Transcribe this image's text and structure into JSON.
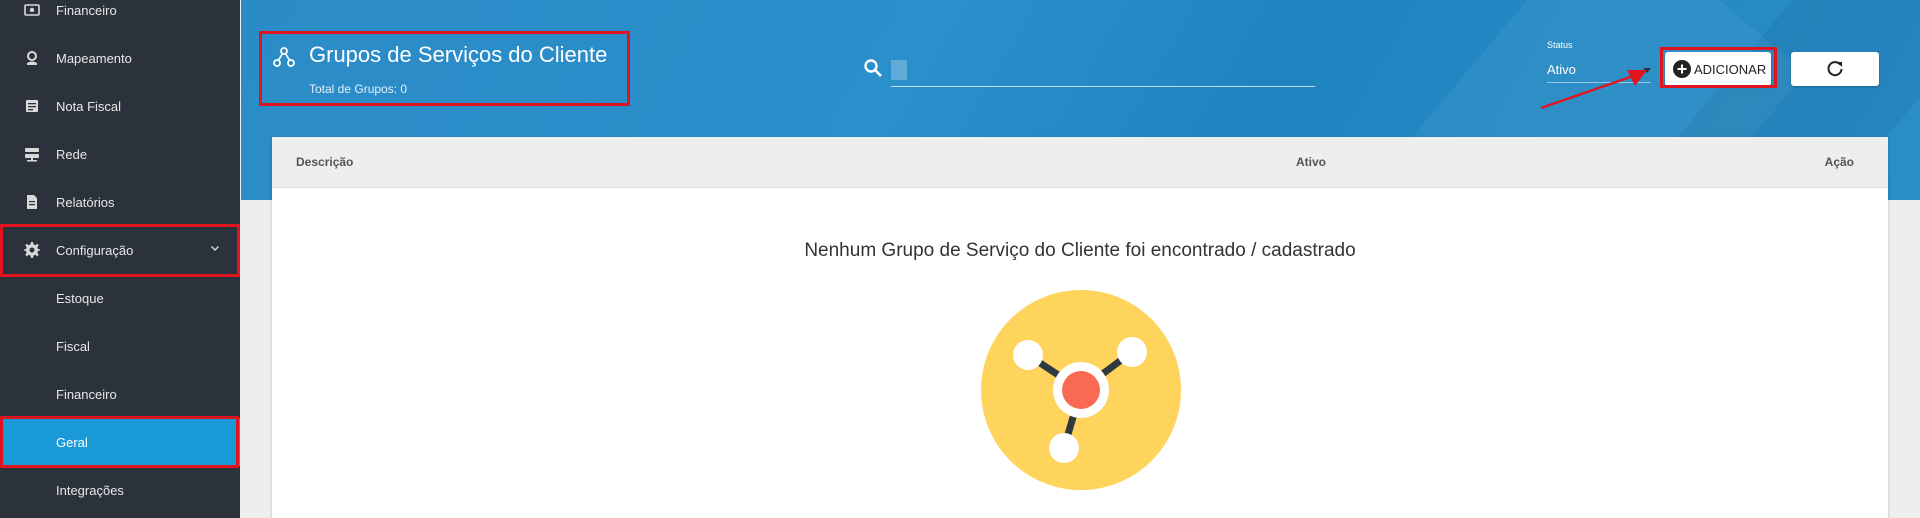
{
  "sidebar": {
    "items": [
      {
        "label": "Financeiro",
        "icon": "money-icon"
      },
      {
        "label": "Mapeamento",
        "icon": "map-pin-icon"
      },
      {
        "label": "Nota Fiscal",
        "icon": "document-icon"
      },
      {
        "label": "Rede",
        "icon": "server-icon"
      },
      {
        "label": "Relatórios",
        "icon": "report-icon"
      },
      {
        "label": "Configuração",
        "icon": "gear-icon"
      }
    ],
    "sub_items": [
      {
        "label": "Estoque"
      },
      {
        "label": "Fiscal"
      },
      {
        "label": "Financeiro"
      },
      {
        "label": "Geral",
        "active": true
      },
      {
        "label": "Integrações"
      }
    ]
  },
  "header": {
    "title": "Grupos de Serviços do Cliente",
    "subtitle": "Total de Grupos: 0",
    "status_label": "Status",
    "status_value": "Ativo",
    "add_label": "ADICIONAR"
  },
  "table": {
    "columns": [
      "Descrição",
      "Ativo",
      "Ação"
    ],
    "empty_message": "Nenhum Grupo de Serviço do Cliente foi encontrado / cadastrado"
  },
  "colors": {
    "sidebar_bg": "#2b323b",
    "active_item": "#1a9ad6",
    "header_blue": "#2a8ec8",
    "highlight_red": "#e0141e",
    "illustration_yellow": "#ffd45c",
    "illustration_red": "#f96a52"
  }
}
